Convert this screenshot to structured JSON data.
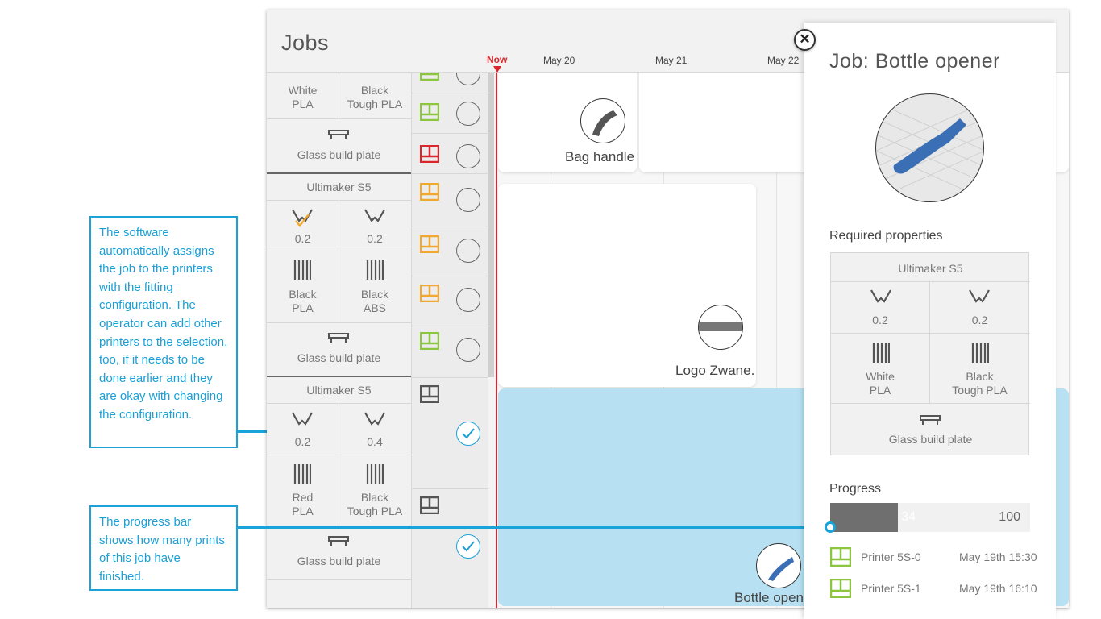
{
  "annotations": {
    "auto_assign": "The software automatically assigns the job to the printers with the fitting configuration. The operator can add other printers to the selection, too, if it needs to be done earlier and they are okay with changing the configuration.",
    "progress": "The progress bar shows how many prints of this job have finished."
  },
  "app": {
    "title": "Jobs",
    "timeline": {
      "now_label": "Now",
      "dates": [
        "May 20",
        "May 21",
        "May 22"
      ]
    }
  },
  "printers": [
    {
      "name": "",
      "materials": [
        {
          "color": "White",
          "type": "PLA"
        },
        {
          "color": "Black",
          "type": "Tough PLA"
        }
      ],
      "plate": "Glass build plate"
    },
    {
      "name": "Ultimaker S5",
      "nozzles": [
        "0.2",
        "0.2"
      ],
      "materials": [
        {
          "color": "Black",
          "type": "PLA"
        },
        {
          "color": "Black",
          "type": "ABS"
        }
      ],
      "plate": "Glass build plate"
    },
    {
      "name": "Ultimaker S5",
      "nozzles": [
        "0.2",
        "0.4"
      ],
      "materials": [
        {
          "color": "Red",
          "type": "PLA"
        },
        {
          "color": "Black",
          "type": "Tough PLA"
        }
      ],
      "plate": "Glass build plate"
    }
  ],
  "jobs": {
    "bag_handle": "Bag handle",
    "logo": "Logo Zwane.",
    "bottle_opener": "Bottle opener"
  },
  "detail": {
    "title_prefix": "Job:",
    "title_name": "Bottle opener",
    "required_heading": "Required properties",
    "required": {
      "printer": "Ultimaker S5",
      "nozzles": [
        "0.2",
        "0.2"
      ],
      "materials": [
        {
          "color": "White",
          "type": "PLA"
        },
        {
          "color": "Black",
          "type": "Tough PLA"
        }
      ],
      "plate": "Glass build plate"
    },
    "progress_heading": "Progress",
    "progress": {
      "done": 34,
      "total": 100,
      "done_label": "34",
      "total_label": "100"
    },
    "prints": [
      {
        "printer": "Printer 5S-0",
        "time": "May 19th 15:30"
      },
      {
        "printer": "Printer 5S-1",
        "time": "May 19th 16:10"
      }
    ]
  },
  "colors": {
    "accent": "#1a9fd6",
    "now_line": "#d9252b",
    "status_green": "#8cc63f",
    "status_orange": "#f0a830",
    "status_red": "#d9252b",
    "status_gray": "#555555",
    "selected_job": "#b7e1f2",
    "model_blue": "#3a6fb5"
  }
}
